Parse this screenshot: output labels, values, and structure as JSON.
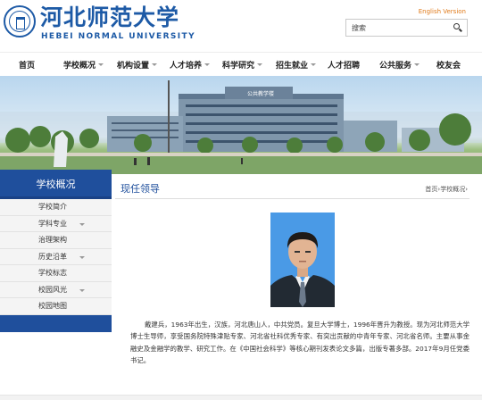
{
  "header": {
    "logo_cn": "河北师范大学",
    "logo_en": "HEBEI NORMAL UNIVERSITY",
    "lang_link": "English Version",
    "search_placeholder": "搜索"
  },
  "nav": [
    {
      "label": "首页",
      "has_menu": false
    },
    {
      "label": "学校概况",
      "has_menu": true
    },
    {
      "label": "机构设置",
      "has_menu": true
    },
    {
      "label": "人才培养",
      "has_menu": true
    },
    {
      "label": "科学研究",
      "has_menu": true
    },
    {
      "label": "招生就业",
      "has_menu": true
    },
    {
      "label": "人才招聘",
      "has_menu": false
    },
    {
      "label": "公共服务",
      "has_menu": true
    },
    {
      "label": "校友会",
      "has_menu": false
    }
  ],
  "banner": {
    "building_sign": "公共教学楼"
  },
  "sidebar": {
    "title": "学校概况",
    "items": [
      {
        "label": "学校简介",
        "has_sub": false
      },
      {
        "label": "学科专业",
        "has_sub": true
      },
      {
        "label": "治理架构",
        "has_sub": false
      },
      {
        "label": "历史沿革",
        "has_sub": true
      },
      {
        "label": "学校标志",
        "has_sub": false
      },
      {
        "label": "校园风光",
        "has_sub": true
      },
      {
        "label": "校园地图",
        "has_sub": false
      }
    ]
  },
  "content": {
    "title": "现任领导",
    "breadcrumb": "首页›学校概况›",
    "bio": "戴建兵，1963年出生，汉族，河北唐山人，中共党员。复旦大学博士，1996年晋升为教授。现为河北师范大学博士生导师，享受国务院特殊津贴专家、河北省社科优秀专家、有突出贡献的中青年专家、河北省名师。主要从事金融史及金融学的教学、研究工作。在《中国社会科学》等核心期刊发表论文多篇，出版专著多部。2017年9月任党委书记。"
  },
  "colors": {
    "brand_blue": "#1f4f9c",
    "accent_orange": "#e07a1a"
  }
}
